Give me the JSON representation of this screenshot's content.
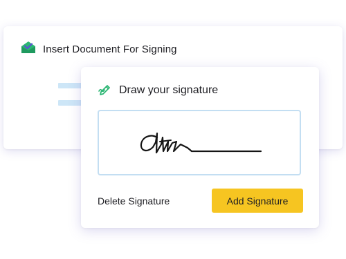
{
  "colors": {
    "brand_green": "#2bb673",
    "brand_purple": "#5b4fd6",
    "accent_yellow": "#f6c521",
    "pad_border": "#c3def2",
    "placeholder_bar": "#cde6f7"
  },
  "back_card": {
    "title": "Insert Document For Signing",
    "icon": "envelope-check-icon"
  },
  "signature_dialog": {
    "title": "Draw your signature",
    "icon": "pen-draw-icon",
    "signature": "drawn-signature",
    "delete_label": "Delete Signature",
    "add_label": "Add Signature"
  }
}
